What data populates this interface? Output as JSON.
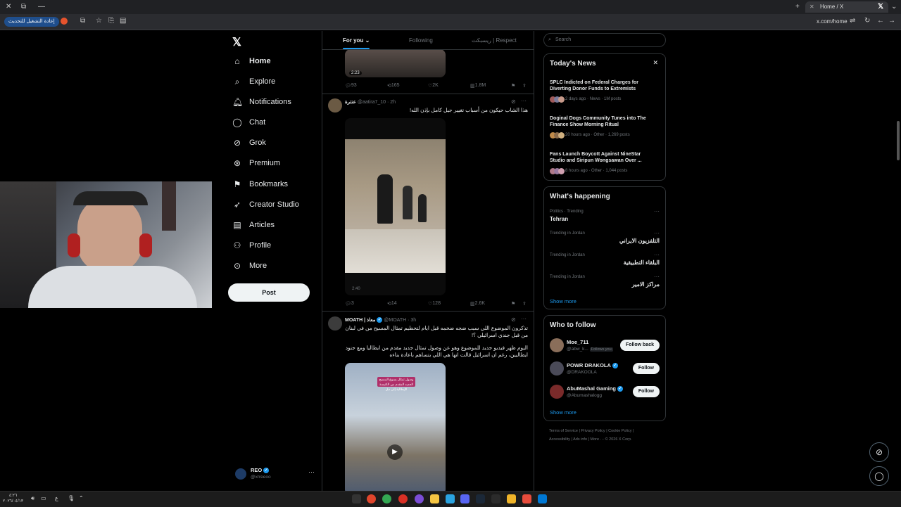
{
  "browser": {
    "tab_title": "Home / X",
    "url": "x.com/home",
    "update_button": "إعادة التشغيل للتحديث"
  },
  "nav": {
    "items": [
      {
        "label": "Home",
        "icon": "home-icon"
      },
      {
        "label": "Explore",
        "icon": "search-icon"
      },
      {
        "label": "Notifications",
        "icon": "bell-icon"
      },
      {
        "label": "Chat",
        "icon": "chat-icon"
      },
      {
        "label": "Grok",
        "icon": "grok-icon"
      },
      {
        "label": "Premium",
        "icon": "premium-icon"
      },
      {
        "label": "Bookmarks",
        "icon": "bookmark-icon"
      },
      {
        "label": "Creator Studio",
        "icon": "rocket-icon"
      },
      {
        "label": "Articles",
        "icon": "articles-icon"
      },
      {
        "label": "Profile",
        "icon": "person-icon"
      },
      {
        "label": "More",
        "icon": "more-circle-icon"
      }
    ],
    "post_label": "Post",
    "account": {
      "name": "REO",
      "handle": "@xrreeoo"
    }
  },
  "feed": {
    "tabs": [
      "For you",
      "Following",
      "ريسبكت | Respect"
    ],
    "tweet0": {
      "video_duration": "2:23",
      "replies": "93",
      "reposts": "165",
      "likes": "2K",
      "views": "1.8M"
    },
    "tweet1": {
      "name": "عنترة",
      "handle": "@aatira7_10 · 2h",
      "text": "هذا الشاب حيكون من أسباب تغيير جيل كامل بإذن الله!",
      "video_time": "2:40",
      "replies": "3",
      "reposts": "14",
      "likes": "128",
      "views": "2.6K"
    },
    "tweet2": {
      "name": "MOATH | معاذ",
      "handle": "@MOATH · 3h",
      "text1": "تذكرون الموضوع اللي سبب ضجه ضخمه قبل ايام لتحطيم تمثال المسيح من في لبنان من قبل جندي اسرائيلي ؟!",
      "text2": "اليوم ظهر فيديو جديد للموضوع وهو عن وصول تمثال جديد مقدم من ايطاليا ومع جنود ايطاليين، رغم ان اسرائيل قالت انها هي اللي بتساهم باعادة بناءه",
      "video_caption": "وصول تمثال يسوع المسيح الجديد المقدم من الكنيسة الإيطالية إلى دبل"
    }
  },
  "sidebar": {
    "search_placeholder": "Search",
    "news": {
      "title": "Today's News",
      "items": [
        {
          "headline": "SPLC Indicted on Federal Charges for Diverting Donor Funds to Extremists",
          "meta": "2 days ago · News · 1M posts"
        },
        {
          "headline": "Doginal Dogs Community Tunes into The Finance Show Morning Ritual",
          "meta": "20 hours ago · Other · 1,269 posts"
        },
        {
          "headline": "Fans Launch Boycott Against NineStar Studio and Siripun Wongsawan Over ...",
          "meta": "8 hours ago · Other · 1,044 posts"
        }
      ]
    },
    "happening": {
      "title": "What's happening",
      "items": [
        {
          "category": "Politics · Trending",
          "name": "Tehran"
        },
        {
          "category": "Trending in Jordan",
          "name": "التلفزيون الايراني"
        },
        {
          "category": "Trending in Jordan",
          "name": "البلقاء التطبيقية"
        },
        {
          "category": "Trending in Jordan",
          "name": "مراكز الامير"
        }
      ],
      "show_more": "Show more"
    },
    "who_to_follow": {
      "title": "Who to follow",
      "users": [
        {
          "name": "Moe_711",
          "handle": "@abw_k...",
          "badge": "Follows you",
          "button": "Follow back"
        },
        {
          "name": "POWR DRAKOLA",
          "handle": "@DRAKOOLA",
          "button": "Follow"
        },
        {
          "name": "AbuMashal Gaming",
          "handle": "@Abumashalogg",
          "button": "Follow"
        }
      ],
      "show_more": "Show more"
    },
    "footer": {
      "line1": "Terms of Service  |  Privacy Policy  |  Cookie Policy  |",
      "line2": "Accessibility  |  Ads info  |  More ···  © 2026 X Corp."
    }
  },
  "taskbar": {
    "clock_time": "٤:٢٦",
    "clock_date": "٢٠٢٦/٠٤/١٣",
    "lang": "ع"
  },
  "colors": {
    "accent": "#1d9bf0",
    "background": "#000000",
    "border": "#2f3336"
  }
}
